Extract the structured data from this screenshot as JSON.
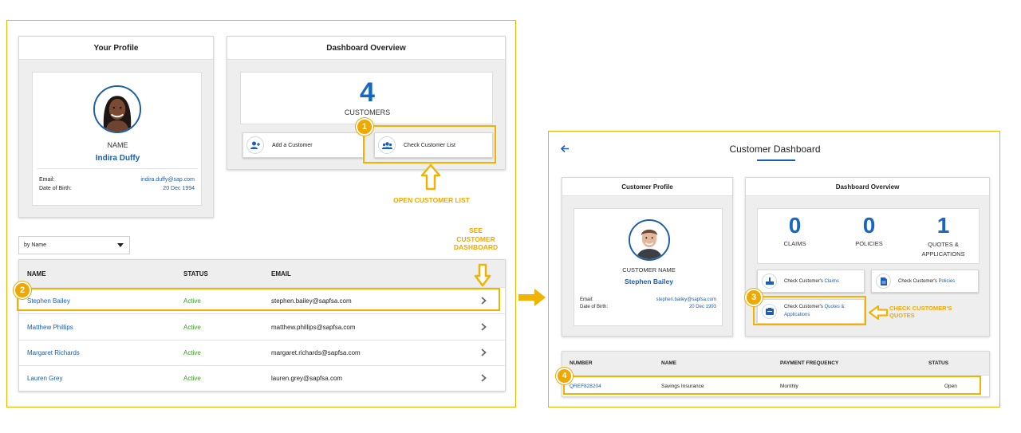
{
  "left": {
    "profile": {
      "title": "Your Profile",
      "name_label": "NAME",
      "name": "Indira Duffy",
      "email_label": "Email:",
      "email": "indira.duffy@sap.com",
      "dob_label": "Date of Birth:",
      "dob": "20 Dec 1994"
    },
    "overview": {
      "title": "Dashboard Overview",
      "count": "4",
      "count_label": "CUSTOMERS",
      "add_label": "Add a Customer",
      "check_label": "Check Customer List"
    },
    "sort": {
      "selected": "by Name"
    },
    "table": {
      "headers": [
        "NAME",
        "STATUS",
        "EMAIL"
      ],
      "rows": [
        {
          "name": "Stephen Bailey",
          "status": "Active",
          "email": "stephen.bailey@sapfsa.com"
        },
        {
          "name": "Matthew Phillips",
          "status": "Active",
          "email": "matthew.phillips@sapfsa.com"
        },
        {
          "name": "Margaret Richards",
          "status": "Active",
          "email": "margaret.richards@sapfsa.com"
        },
        {
          "name": "Lauren Grey",
          "status": "Active",
          "email": "lauren.grey@sapfsa.com"
        }
      ]
    }
  },
  "right": {
    "title": "Customer Dashboard",
    "profile": {
      "title": "Customer Profile",
      "name_label": "CUSTOMER NAME",
      "name": "Stephen Bailey",
      "email_label": "Email:",
      "email": "stephen.bailey@sapfsa.com",
      "dob_label": "Date of Birth:",
      "dob": "20 Dec 1993"
    },
    "overview": {
      "title": "Dashboard Overview",
      "stats": [
        {
          "value": "0",
          "label": "CLAIMS"
        },
        {
          "value": "0",
          "label": "POLICIES"
        },
        {
          "value": "1",
          "label_line1": "QUOTES &",
          "label_line2": "APPLICATIONS"
        }
      ],
      "claims_prefix": "Check Customer's ",
      "claims_link": "Claims",
      "policies_prefix": "Check Customer's ",
      "policies_link": "Policies",
      "quotes_prefix": "Check Customer's ",
      "quotes_link_1": "Quotes &",
      "quotes_link_2": "Applications"
    },
    "table": {
      "headers": [
        "NUMBER",
        "NAME",
        "PAYMENT FREQUENCY",
        "STATUS"
      ],
      "rows": [
        {
          "number": "QREF828204",
          "name": "Savings Insurance",
          "frequency": "Monthly",
          "status": "Open"
        }
      ]
    }
  },
  "annotations": {
    "step1": "1",
    "step2": "2",
    "step3": "3",
    "step4": "4",
    "open_list": "OPEN CUSTOMER LIST",
    "see_line1": "SEE",
    "see_line2": "CUSTOMER",
    "see_line3": "DASHBOARD",
    "check_line1": "CHECK CUSTOMER'S",
    "check_line2": "QUOTES"
  },
  "colors": {
    "accent": "#f0b400",
    "link": "#1a5fb4",
    "active": "#3d9b2e",
    "number": "#1766c6"
  }
}
